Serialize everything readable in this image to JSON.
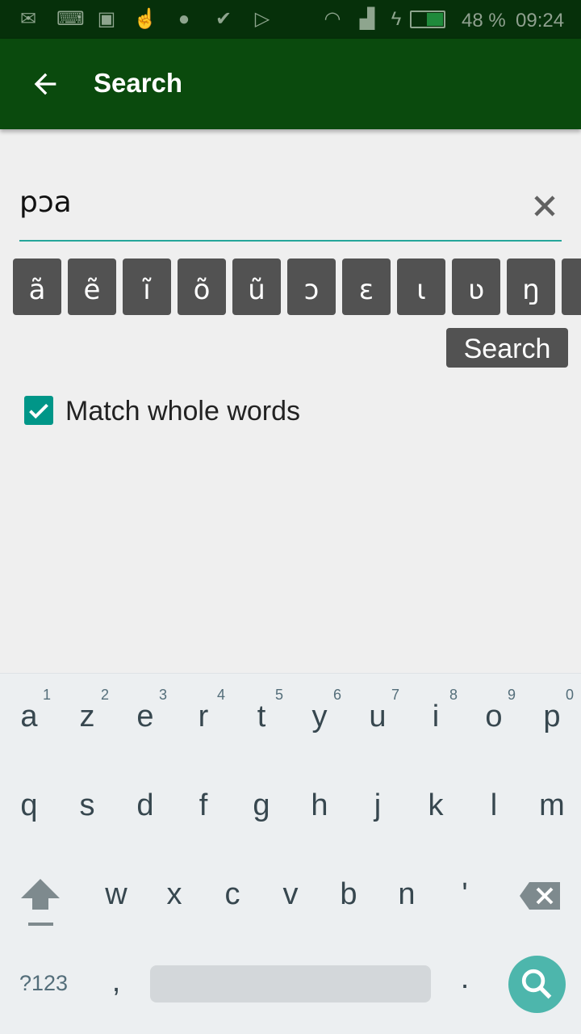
{
  "status_bar": {
    "icons": [
      "gmail-icon",
      "keyboard-icon",
      "gallery-icon",
      "touchpal-icon",
      "brush-icon",
      "tasks-icon",
      "play-store-icon",
      "wifi-icon",
      "signal-icon",
      "charging-icon",
      "battery-icon"
    ],
    "battery": "48 %",
    "time": "09:24",
    "battery_level": 48
  },
  "app_bar": {
    "title": "Search",
    "back_icon": "arrow-left-icon"
  },
  "search": {
    "value": "pɔa",
    "clear_icon": "close-icon",
    "underline_color": "#26a69a"
  },
  "special_chars": [
    "ã",
    "ẽ",
    "ĩ",
    "õ",
    "ũ",
    "ɔ",
    "ɛ",
    "ɩ",
    "ʋ",
    "ŋ"
  ],
  "search_button": "Search",
  "match_whole_words": {
    "label": "Match whole words",
    "checked": true,
    "color": "#009688"
  },
  "keyboard": {
    "row1": [
      "a",
      "z",
      "e",
      "r",
      "t",
      "y",
      "u",
      "i",
      "o",
      "p"
    ],
    "row1_hints": [
      "1",
      "2",
      "3",
      "4",
      "5",
      "6",
      "7",
      "8",
      "9",
      "0"
    ],
    "row2": [
      "q",
      "s",
      "d",
      "f",
      "g",
      "h",
      "j",
      "k",
      "l",
      "m"
    ],
    "row3": [
      "w",
      "x",
      "c",
      "v",
      "b",
      "n",
      "'"
    ],
    "symbols": "?123",
    "comma": ",",
    "period": ".",
    "action_color": "#4db6ac"
  }
}
